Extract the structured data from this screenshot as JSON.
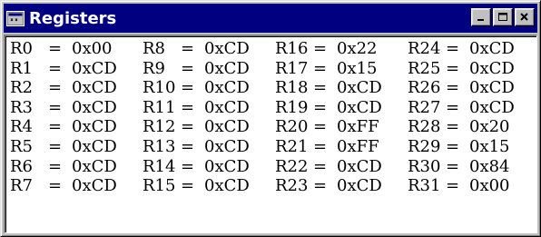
{
  "window": {
    "title": "Registers",
    "icon": "window-system-menu-icon",
    "controls": [
      "minimize-icon",
      "maximize-icon",
      "close-icon"
    ]
  },
  "registers": {
    "equals": "=",
    "rows": [
      [
        {
          "name": "R0",
          "value": "0x00"
        },
        {
          "name": "R8",
          "value": "0xCD"
        },
        {
          "name": "R16",
          "value": "0x22"
        },
        {
          "name": "R24",
          "value": "0xCD"
        }
      ],
      [
        {
          "name": "R1",
          "value": "0xCD"
        },
        {
          "name": "R9",
          "value": "0xCD"
        },
        {
          "name": "R17",
          "value": "0x15"
        },
        {
          "name": "R25",
          "value": "0xCD"
        }
      ],
      [
        {
          "name": "R2",
          "value": "0xCD"
        },
        {
          "name": "R10",
          "value": "0xCD"
        },
        {
          "name": "R18",
          "value": "0xCD"
        },
        {
          "name": "R26",
          "value": "0xCD"
        }
      ],
      [
        {
          "name": "R3",
          "value": "0xCD"
        },
        {
          "name": "R11",
          "value": "0xCD"
        },
        {
          "name": "R19",
          "value": "0xCD"
        },
        {
          "name": "R27",
          "value": "0xCD"
        }
      ],
      [
        {
          "name": "R4",
          "value": "0xCD"
        },
        {
          "name": "R12",
          "value": "0xCD"
        },
        {
          "name": "R20",
          "value": "0xFF"
        },
        {
          "name": "R28",
          "value": "0x20"
        }
      ],
      [
        {
          "name": "R5",
          "value": "0xCD"
        },
        {
          "name": "R13",
          "value": "0xCD"
        },
        {
          "name": "R21",
          "value": "0xFF"
        },
        {
          "name": "R29",
          "value": "0x15"
        }
      ],
      [
        {
          "name": "R6",
          "value": "0xCD"
        },
        {
          "name": "R14",
          "value": "0xCD"
        },
        {
          "name": "R22",
          "value": "0xCD"
        },
        {
          "name": "R30",
          "value": "0x84"
        }
      ],
      [
        {
          "name": "R7",
          "value": "0xCD"
        },
        {
          "name": "R15",
          "value": "0xCD"
        },
        {
          "name": "R23",
          "value": "0xCD"
        },
        {
          "name": "R31",
          "value": "0x00"
        }
      ]
    ]
  },
  "colors": {
    "titlebar": "#000080",
    "face": "#c0c0c0",
    "client": "#ffffff"
  }
}
